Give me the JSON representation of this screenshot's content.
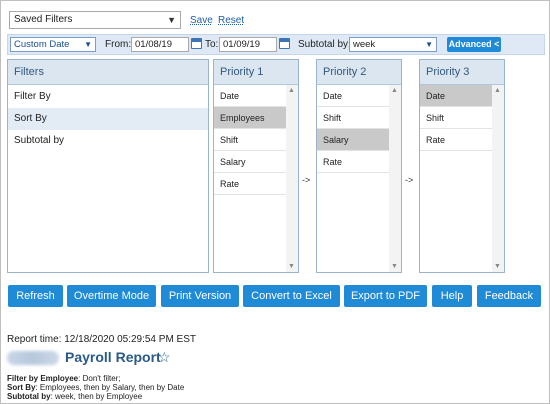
{
  "top": {
    "saved_filters": "Saved Filters",
    "save": "Save",
    "reset": "Reset"
  },
  "filterbar": {
    "date_range": "Custom Date",
    "from_label": "From:",
    "from_value": "01/08/19",
    "to_label": "To:",
    "to_value": "01/09/19",
    "subtotal_label": "Subtotal by:",
    "subtotal_value": "week",
    "advanced": "Advanced <"
  },
  "filters_panel": {
    "header": "Filters",
    "items": [
      "Filter By",
      "Sort By",
      "Subtotal by"
    ]
  },
  "priority1": {
    "header": "Priority 1",
    "items": [
      "Date",
      "Employees",
      "Shift",
      "Salary",
      "Rate"
    ]
  },
  "priority2": {
    "header": "Priority 2",
    "items": [
      "Date",
      "Shift",
      "Salary",
      "Rate"
    ]
  },
  "priority3": {
    "header": "Priority 3",
    "items": [
      "Date",
      "Shift",
      "Rate"
    ]
  },
  "arrows": {
    "a1": "->",
    "a2": "->"
  },
  "buttons": {
    "refresh": "Refresh",
    "overtime": "Overtime Mode",
    "print": "Print Version",
    "excel": "Convert to Excel",
    "pdf": "Export to PDF",
    "help": "Help",
    "feedback": "Feedback"
  },
  "report": {
    "time": "Report time: 12/18/2020 05:29:54 PM EST",
    "title": "Payroll Report",
    "star": "☆",
    "filter_by_label": "Filter by Employee",
    "filter_by_value": ": Don't filter;",
    "sort_by_label": "Sort By",
    "sort_by_value": ": Employees, then by Salary, then by Date",
    "subtotal_label": "Subtotal by",
    "subtotal_value": ": week, then by Employee"
  },
  "colors": {
    "accent": "#1f8ad6",
    "header_bg": "#dbe6f1",
    "selected_gray": "#c9c9c9"
  }
}
